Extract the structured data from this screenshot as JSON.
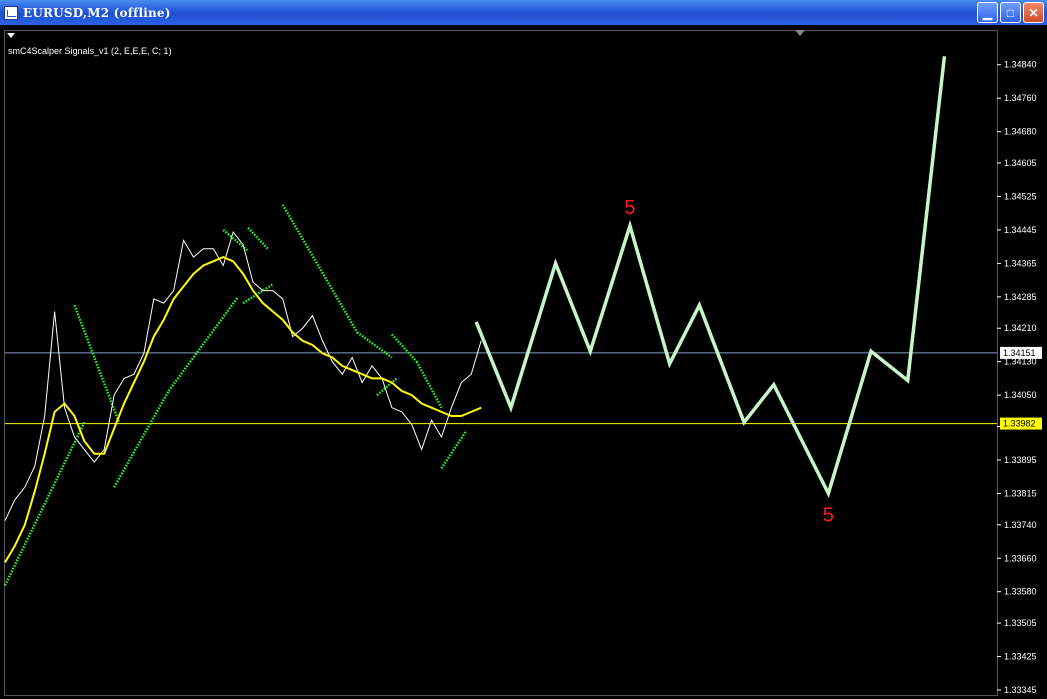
{
  "window": {
    "title": "EURUSD,M2 (offline)",
    "minimize_icon": "minimize-icon",
    "maximize_icon": "maximize-icon",
    "close_icon": "close-icon"
  },
  "indicator": {
    "label": "smC4Scalper Signals_v1 (2, E,E,E, C; 1)"
  },
  "colors": {
    "background": "#000000",
    "price_line": "#ffffff",
    "ma_line": "#ffff00",
    "band_dots": "#22ff22",
    "zigzag": "#c8f5c8",
    "annotation": "#ff1a1a",
    "bid_line": "#8b9cc8",
    "yellow_level": "#ffff00",
    "axis_text": "#ffffff"
  },
  "chart_data": {
    "type": "line",
    "symbol": "EURUSD",
    "timeframe": "M2",
    "ylim": [
      1.33345,
      1.3488
    ],
    "y_ticks": [
      "1.34840",
      "1.34760",
      "1.34680",
      "1.34605",
      "1.34525",
      "1.34445",
      "1.34365",
      "1.34285",
      "1.34210",
      "1.34130",
      "1.34050",
      "1.33975",
      "1.33895",
      "1.33815",
      "1.33740",
      "1.33660",
      "1.33580",
      "1.33505",
      "1.33425",
      "1.33345"
    ],
    "current_price_label": "1.34151",
    "current_price": 1.34151,
    "level_label": "1.33982",
    "level": 1.33982,
    "price_series_x": [
      0.0,
      0.01,
      0.02,
      0.03,
      0.04,
      0.05,
      0.06,
      0.07,
      0.08,
      0.09,
      0.1,
      0.11,
      0.12,
      0.13,
      0.14,
      0.15,
      0.16,
      0.17,
      0.18,
      0.19,
      0.2,
      0.21,
      0.22,
      0.23,
      0.24,
      0.25,
      0.26,
      0.27,
      0.28,
      0.29,
      0.3,
      0.31,
      0.32,
      0.33,
      0.34,
      0.35,
      0.36,
      0.37,
      0.38,
      0.39,
      0.4,
      0.41,
      0.42,
      0.43,
      0.44,
      0.45,
      0.46,
      0.47,
      0.48
    ],
    "price_series_y": [
      1.3375,
      1.338,
      1.3383,
      1.3388,
      1.34,
      1.3425,
      1.3402,
      1.3395,
      1.3392,
      1.3389,
      1.3392,
      1.3405,
      1.3409,
      1.341,
      1.3415,
      1.3428,
      1.3427,
      1.343,
      1.3442,
      1.3438,
      1.344,
      1.344,
      1.3436,
      1.3444,
      1.3441,
      1.3432,
      1.343,
      1.343,
      1.3428,
      1.3419,
      1.3421,
      1.3424,
      1.3418,
      1.3413,
      1.341,
      1.3414,
      1.3408,
      1.3412,
      1.3409,
      1.3402,
      1.3401,
      1.3398,
      1.3392,
      1.3399,
      1.3395,
      1.3402,
      1.3408,
      1.341,
      1.3418
    ],
    "ma_series_y": [
      1.3365,
      1.3369,
      1.3374,
      1.3382,
      1.3391,
      1.3401,
      1.3403,
      1.34,
      1.3394,
      1.3391,
      1.3391,
      1.3397,
      1.3403,
      1.3408,
      1.3413,
      1.3419,
      1.3423,
      1.3428,
      1.3431,
      1.3434,
      1.3436,
      1.3437,
      1.3438,
      1.3437,
      1.3434,
      1.343,
      1.3427,
      1.3425,
      1.3423,
      1.342,
      1.3418,
      1.3417,
      1.3415,
      1.3414,
      1.3412,
      1.3411,
      1.341,
      1.3409,
      1.3409,
      1.3408,
      1.3406,
      1.3405,
      1.3403,
      1.3402,
      1.3401,
      1.34,
      1.34,
      1.3401,
      1.3402
    ],
    "zigzag_x": [
      0.475,
      0.51,
      0.555,
      0.59,
      0.63,
      0.67,
      0.7,
      0.745,
      0.775,
      0.83,
      0.873,
      0.91,
      0.947
    ],
    "zigzag_y": [
      1.34225,
      1.3402,
      1.34365,
      1.34155,
      1.34455,
      1.34125,
      1.34265,
      1.33985,
      1.34075,
      1.33815,
      1.34155,
      1.34085,
      1.3486
    ],
    "annotations": [
      {
        "text": "5",
        "x": 0.63,
        "y": 1.34455,
        "pos": "above"
      },
      {
        "text": "5",
        "x": 0.83,
        "y": 1.33815,
        "pos": "below"
      }
    ],
    "band_segments_upper": [
      {
        "x0": 0.07,
        "y0": 1.34265,
        "x1": 0.115,
        "y1": 1.33985
      },
      {
        "x0": 0.22,
        "y0": 1.34445,
        "x1": 0.245,
        "y1": 1.34395
      },
      {
        "x0": 0.245,
        "y0": 1.3445,
        "x1": 0.265,
        "y1": 1.344
      },
      {
        "x0": 0.28,
        "y0": 1.34505,
        "x1": 0.355,
        "y1": 1.342
      },
      {
        "x0": 0.355,
        "y0": 1.342,
        "x1": 0.39,
        "y1": 1.3414
      },
      {
        "x0": 0.39,
        "y0": 1.34195,
        "x1": 0.415,
        "y1": 1.3413
      },
      {
        "x0": 0.415,
        "y0": 1.3413,
        "x1": 0.44,
        "y1": 1.3402
      }
    ],
    "band_segments_lower": [
      {
        "x0": 0.0,
        "y0": 1.33595,
        "x1": 0.08,
        "y1": 1.33985
      },
      {
        "x0": 0.11,
        "y0": 1.3383,
        "x1": 0.165,
        "y1": 1.3406
      },
      {
        "x0": 0.165,
        "y0": 1.3406,
        "x1": 0.235,
        "y1": 1.34285
      },
      {
        "x0": 0.24,
        "y0": 1.3427,
        "x1": 0.27,
        "y1": 1.34315
      },
      {
        "x0": 0.375,
        "y0": 1.3405,
        "x1": 0.395,
        "y1": 1.3409
      },
      {
        "x0": 0.44,
        "y0": 1.33875,
        "x1": 0.465,
        "y1": 1.33965
      }
    ]
  }
}
